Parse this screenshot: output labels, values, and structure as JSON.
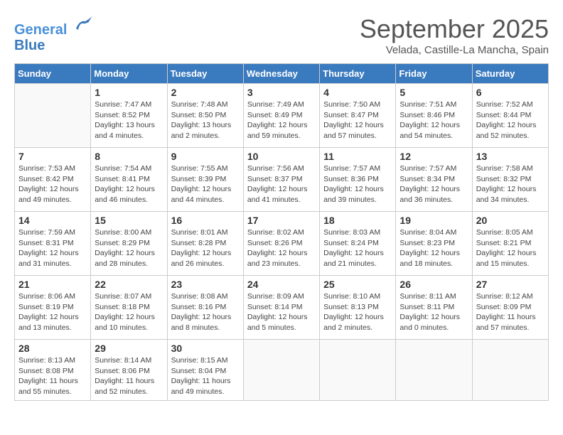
{
  "header": {
    "logo_line1": "General",
    "logo_line2": "Blue",
    "month": "September 2025",
    "location": "Velada, Castille-La Mancha, Spain"
  },
  "weekdays": [
    "Sunday",
    "Monday",
    "Tuesday",
    "Wednesday",
    "Thursday",
    "Friday",
    "Saturday"
  ],
  "weeks": [
    [
      {
        "day": "",
        "sunrise": "",
        "sunset": "",
        "daylight": ""
      },
      {
        "day": "1",
        "sunrise": "Sunrise: 7:47 AM",
        "sunset": "Sunset: 8:52 PM",
        "daylight": "Daylight: 13 hours and 4 minutes."
      },
      {
        "day": "2",
        "sunrise": "Sunrise: 7:48 AM",
        "sunset": "Sunset: 8:50 PM",
        "daylight": "Daylight: 13 hours and 2 minutes."
      },
      {
        "day": "3",
        "sunrise": "Sunrise: 7:49 AM",
        "sunset": "Sunset: 8:49 PM",
        "daylight": "Daylight: 12 hours and 59 minutes."
      },
      {
        "day": "4",
        "sunrise": "Sunrise: 7:50 AM",
        "sunset": "Sunset: 8:47 PM",
        "daylight": "Daylight: 12 hours and 57 minutes."
      },
      {
        "day": "5",
        "sunrise": "Sunrise: 7:51 AM",
        "sunset": "Sunset: 8:46 PM",
        "daylight": "Daylight: 12 hours and 54 minutes."
      },
      {
        "day": "6",
        "sunrise": "Sunrise: 7:52 AM",
        "sunset": "Sunset: 8:44 PM",
        "daylight": "Daylight: 12 hours and 52 minutes."
      }
    ],
    [
      {
        "day": "7",
        "sunrise": "Sunrise: 7:53 AM",
        "sunset": "Sunset: 8:42 PM",
        "daylight": "Daylight: 12 hours and 49 minutes."
      },
      {
        "day": "8",
        "sunrise": "Sunrise: 7:54 AM",
        "sunset": "Sunset: 8:41 PM",
        "daylight": "Daylight: 12 hours and 46 minutes."
      },
      {
        "day": "9",
        "sunrise": "Sunrise: 7:55 AM",
        "sunset": "Sunset: 8:39 PM",
        "daylight": "Daylight: 12 hours and 44 minutes."
      },
      {
        "day": "10",
        "sunrise": "Sunrise: 7:56 AM",
        "sunset": "Sunset: 8:37 PM",
        "daylight": "Daylight: 12 hours and 41 minutes."
      },
      {
        "day": "11",
        "sunrise": "Sunrise: 7:57 AM",
        "sunset": "Sunset: 8:36 PM",
        "daylight": "Daylight: 12 hours and 39 minutes."
      },
      {
        "day": "12",
        "sunrise": "Sunrise: 7:57 AM",
        "sunset": "Sunset: 8:34 PM",
        "daylight": "Daylight: 12 hours and 36 minutes."
      },
      {
        "day": "13",
        "sunrise": "Sunrise: 7:58 AM",
        "sunset": "Sunset: 8:32 PM",
        "daylight": "Daylight: 12 hours and 34 minutes."
      }
    ],
    [
      {
        "day": "14",
        "sunrise": "Sunrise: 7:59 AM",
        "sunset": "Sunset: 8:31 PM",
        "daylight": "Daylight: 12 hours and 31 minutes."
      },
      {
        "day": "15",
        "sunrise": "Sunrise: 8:00 AM",
        "sunset": "Sunset: 8:29 PM",
        "daylight": "Daylight: 12 hours and 28 minutes."
      },
      {
        "day": "16",
        "sunrise": "Sunrise: 8:01 AM",
        "sunset": "Sunset: 8:28 PM",
        "daylight": "Daylight: 12 hours and 26 minutes."
      },
      {
        "day": "17",
        "sunrise": "Sunrise: 8:02 AM",
        "sunset": "Sunset: 8:26 PM",
        "daylight": "Daylight: 12 hours and 23 minutes."
      },
      {
        "day": "18",
        "sunrise": "Sunrise: 8:03 AM",
        "sunset": "Sunset: 8:24 PM",
        "daylight": "Daylight: 12 hours and 21 minutes."
      },
      {
        "day": "19",
        "sunrise": "Sunrise: 8:04 AM",
        "sunset": "Sunset: 8:23 PM",
        "daylight": "Daylight: 12 hours and 18 minutes."
      },
      {
        "day": "20",
        "sunrise": "Sunrise: 8:05 AM",
        "sunset": "Sunset: 8:21 PM",
        "daylight": "Daylight: 12 hours and 15 minutes."
      }
    ],
    [
      {
        "day": "21",
        "sunrise": "Sunrise: 8:06 AM",
        "sunset": "Sunset: 8:19 PM",
        "daylight": "Daylight: 12 hours and 13 minutes."
      },
      {
        "day": "22",
        "sunrise": "Sunrise: 8:07 AM",
        "sunset": "Sunset: 8:18 PM",
        "daylight": "Daylight: 12 hours and 10 minutes."
      },
      {
        "day": "23",
        "sunrise": "Sunrise: 8:08 AM",
        "sunset": "Sunset: 8:16 PM",
        "daylight": "Daylight: 12 hours and 8 minutes."
      },
      {
        "day": "24",
        "sunrise": "Sunrise: 8:09 AM",
        "sunset": "Sunset: 8:14 PM",
        "daylight": "Daylight: 12 hours and 5 minutes."
      },
      {
        "day": "25",
        "sunrise": "Sunrise: 8:10 AM",
        "sunset": "Sunset: 8:13 PM",
        "daylight": "Daylight: 12 hours and 2 minutes."
      },
      {
        "day": "26",
        "sunrise": "Sunrise: 8:11 AM",
        "sunset": "Sunset: 8:11 PM",
        "daylight": "Daylight: 12 hours and 0 minutes."
      },
      {
        "day": "27",
        "sunrise": "Sunrise: 8:12 AM",
        "sunset": "Sunset: 8:09 PM",
        "daylight": "Daylight: 11 hours and 57 minutes."
      }
    ],
    [
      {
        "day": "28",
        "sunrise": "Sunrise: 8:13 AM",
        "sunset": "Sunset: 8:08 PM",
        "daylight": "Daylight: 11 hours and 55 minutes."
      },
      {
        "day": "29",
        "sunrise": "Sunrise: 8:14 AM",
        "sunset": "Sunset: 8:06 PM",
        "daylight": "Daylight: 11 hours and 52 minutes."
      },
      {
        "day": "30",
        "sunrise": "Sunrise: 8:15 AM",
        "sunset": "Sunset: 8:04 PM",
        "daylight": "Daylight: 11 hours and 49 minutes."
      },
      {
        "day": "",
        "sunrise": "",
        "sunset": "",
        "daylight": ""
      },
      {
        "day": "",
        "sunrise": "",
        "sunset": "",
        "daylight": ""
      },
      {
        "day": "",
        "sunrise": "",
        "sunset": "",
        "daylight": ""
      },
      {
        "day": "",
        "sunrise": "",
        "sunset": "",
        "daylight": ""
      }
    ]
  ]
}
